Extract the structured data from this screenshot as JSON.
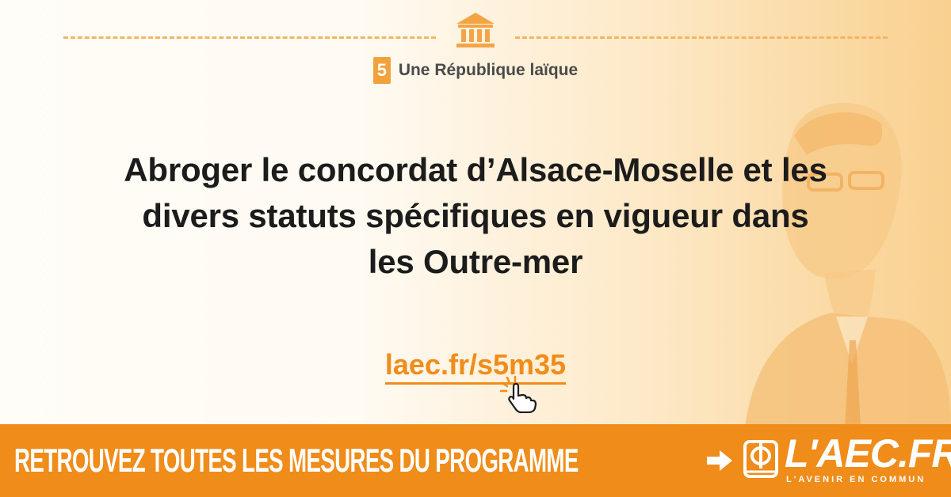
{
  "theme": {
    "number": "5",
    "label": "Une République laïque"
  },
  "headline": {
    "line1": "Abroger le concordat d’Alsace-Moselle et les",
    "line2": "divers statuts spécifiques en vigueur dans",
    "line3": "les Outre-mer"
  },
  "link": {
    "text": "laec.fr/s5m35"
  },
  "footer": {
    "cta": "RETROUVEZ TOUTES LES MESURES DU PROGRAMME",
    "logo_text": "L'AEC.FR",
    "logo_tagline": "L'AVENIR EN COMMUN"
  },
  "icons": {
    "temple": "temple-icon",
    "pointer": "pointer-hand-icon",
    "arrow": "arrow-right-icon",
    "logo": "phi-book-logo-icon"
  },
  "colors": {
    "accent": "#f08c1a",
    "badge": "#f1a23c",
    "dashes": "#f3b55f",
    "headline": "#1c1c1c"
  }
}
